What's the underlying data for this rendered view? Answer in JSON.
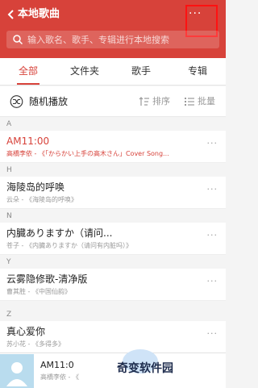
{
  "header": {
    "title": "本地歌曲",
    "more_label": "···"
  },
  "search": {
    "placeholder": "输入歌名、歌手、专辑进行本地搜索"
  },
  "tabs": [
    {
      "label": "全部",
      "active": true
    },
    {
      "label": "文件夹",
      "active": false
    },
    {
      "label": "歌手",
      "active": false
    },
    {
      "label": "专辑",
      "active": false
    }
  ],
  "actions": {
    "shuffle_label": "随机播放",
    "sort_label": "排序",
    "batch_label": "批量"
  },
  "sections": [
    {
      "letter": "A",
      "songs": [
        {
          "title": "AM11:00",
          "subtitle": "高橋李依 - 《「からかい上手の高木さん」Cover Song...",
          "playing": true
        }
      ]
    },
    {
      "letter": "H",
      "songs": [
        {
          "title": "海陵岛的呼唤",
          "subtitle": "云朵 - 《海陵岛的呼唤》",
          "playing": false
        }
      ]
    },
    {
      "letter": "N",
      "songs": [
        {
          "title": "内臓ありますか（请问...",
          "subtitle": "苍子 - 《内臓ありますか（请问有内脏吗）》",
          "playing": false
        }
      ]
    },
    {
      "letter": "Y",
      "songs": [
        {
          "title": "云雾隐修歌-清净版",
          "subtitle": "曹其胜 - 《中国仙韵》",
          "playing": false
        }
      ]
    },
    {
      "letter": "Z",
      "songs": [
        {
          "title": "真心爱你",
          "subtitle": "苏小花 - 《多得多》",
          "playing": false
        }
      ]
    }
  ],
  "row_more_label": "···",
  "player": {
    "title": "AM11:0",
    "subtitle": "高橋李依 - 《"
  },
  "watermark": "奇变软件园",
  "colors": {
    "brand_red": "#d7423a",
    "highlight_box": "#ff1111"
  }
}
